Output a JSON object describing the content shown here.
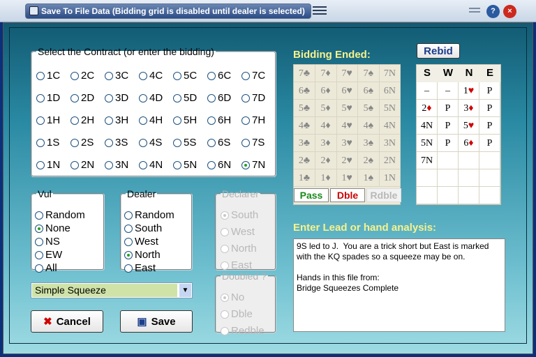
{
  "window": {
    "title": "Save To File Data (Bidding grid is disabled until dealer is selected)",
    "help": "?",
    "close": "×"
  },
  "contract": {
    "legend": "Select the Contract (or enter the bidding)",
    "rows": [
      [
        "1C",
        "2C",
        "3C",
        "4C",
        "5C",
        "6C",
        "7C"
      ],
      [
        "1D",
        "2D",
        "3D",
        "4D",
        "5D",
        "6D",
        "7D"
      ],
      [
        "1H",
        "2H",
        "3H",
        "4H",
        "5H",
        "6H",
        "7H"
      ],
      [
        "1S",
        "2S",
        "3S",
        "4S",
        "5S",
        "6S",
        "7S"
      ],
      [
        "1N",
        "2N",
        "3N",
        "4N",
        "5N",
        "6N",
        "7N"
      ]
    ],
    "selected": "7N"
  },
  "vul": {
    "legend": "Vul",
    "options": [
      "Random",
      "None",
      "NS",
      "EW",
      "All"
    ],
    "selected": "None"
  },
  "dealer": {
    "legend": "Dealer",
    "options": [
      "Random",
      "South",
      "West",
      "North",
      "East"
    ],
    "selected": "North"
  },
  "declarer": {
    "legend": "Declarer",
    "options": [
      "South",
      "West",
      "North",
      "East"
    ],
    "selected": "South"
  },
  "doubled": {
    "legend": "Doubled ?",
    "options": [
      "No",
      "Dble",
      "Redble"
    ],
    "selected": "No"
  },
  "dropdown": {
    "value": "Simple Squeeze"
  },
  "buttons": {
    "cancel": "Cancel",
    "save": "Save",
    "rebid": "Rebid",
    "pass": "Pass",
    "double": "Dble",
    "redouble": "Rdble"
  },
  "bidding": {
    "title": "Bidding Ended:",
    "levels": [
      "7",
      "6",
      "5",
      "4",
      "3",
      "2",
      "1"
    ],
    "suits": [
      "♣",
      "♦",
      "♥",
      "♠",
      "N"
    ]
  },
  "auction": {
    "headers": [
      "S",
      "W",
      "N",
      "E"
    ],
    "rows": [
      [
        "–",
        "–",
        "1♥",
        "P"
      ],
      [
        "2♦",
        "P",
        "3♦",
        "P"
      ],
      [
        "4N",
        "P",
        "5♥",
        "P"
      ],
      [
        "5N",
        "P",
        "6♦",
        "P"
      ],
      [
        "7N",
        "",
        "",
        ""
      ],
      [
        "",
        "",
        "",
        ""
      ],
      [
        "",
        "",
        "",
        ""
      ]
    ]
  },
  "lead": {
    "title": "Enter Lead or hand analysis:",
    "text": "9S led to J.  You are a trick short but East is marked with the KQ spades so a squeeze may be on.\n\nHands in this file from:\nBridge Squeezes Complete"
  }
}
